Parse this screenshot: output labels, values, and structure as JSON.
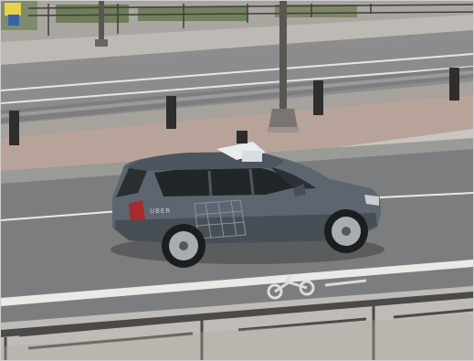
{
  "scene": {
    "vehicle": {
      "brand_marking": "UBER",
      "body_color": "#5d6670"
    },
    "road_marking_text": "",
    "colors": {
      "asphalt": "#7c7d7f",
      "sidewalk": "#b8a39a",
      "curb": "#9a9a97",
      "lane_line": "#e9e9e6",
      "railing": "#4b4a49"
    }
  }
}
